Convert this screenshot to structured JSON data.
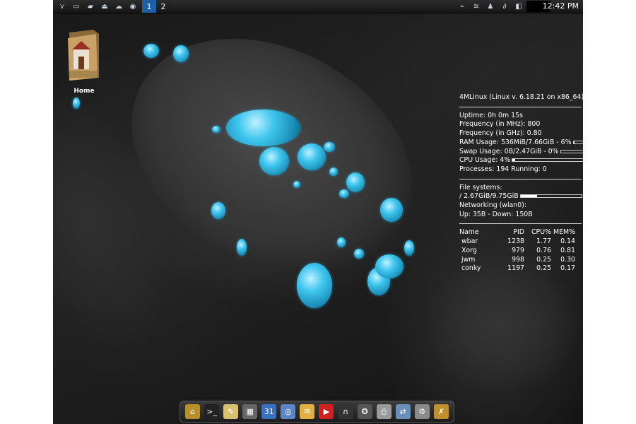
{
  "top_panel": {
    "workspaces": [
      "1",
      "2"
    ],
    "active_workspace": "1",
    "clock": "12:42 PM"
  },
  "desktop": {
    "home_icon_label": "Home"
  },
  "conky": {
    "header": "4MLinux (Linux v. 6.18.21 on x86_64)",
    "uptime": "Uptime: 0h 0m 15s",
    "freq_mhz": "Frequency (in MHz): 800",
    "freq_ghz": "Frequency (in GHz): 0.80",
    "ram": "RAM Usage: 536MiB/7.66GiB - 6%",
    "ram_percent": 6,
    "swap": "Swap Usage: 0B/2.47GiB - 0%",
    "swap_percent": 0,
    "cpu": "CPU Usage: 4%",
    "cpu_percent": 4,
    "processes": "Processes: 194  Running: 0",
    "filesystems_label": "File systems:",
    "root_fs": " /  2.67GiB/9.75GiB",
    "root_fs_percent": 27,
    "networking": "Networking (wlan0):",
    "updown": "Up: 35B  - Down: 150B",
    "proc_header": [
      "Name",
      "PID",
      "CPU%",
      "MEM%"
    ],
    "processes_list": [
      {
        "name": "wbar",
        "pid": "1238",
        "cpu": "1.77",
        "mem": "0.14"
      },
      {
        "name": "Xorg",
        "pid": "979",
        "cpu": "0.76",
        "mem": "0.81"
      },
      {
        "name": "jwm",
        "pid": "998",
        "cpu": "0.25",
        "mem": "0.30"
      },
      {
        "name": "conky",
        "pid": "1197",
        "cpu": "0.25",
        "mem": "0.17"
      }
    ]
  },
  "dock": {
    "icons": [
      {
        "name": "home-folder-icon",
        "color": "#b8902a",
        "glyph": "⌂"
      },
      {
        "name": "terminal-icon",
        "color": "#222222",
        "glyph": ">_"
      },
      {
        "name": "text-editor-icon",
        "color": "#d8c070",
        "glyph": "✎"
      },
      {
        "name": "calculator-icon",
        "color": "#666666",
        "glyph": "▦"
      },
      {
        "name": "calendar-icon",
        "color": "#3a70c0",
        "glyph": "31"
      },
      {
        "name": "web-browser-icon",
        "color": "#5a86c8",
        "glyph": "◎"
      },
      {
        "name": "email-icon",
        "color": "#e0b040",
        "glyph": "✉"
      },
      {
        "name": "youtube-icon",
        "color": "#d02020",
        "glyph": "▶"
      },
      {
        "name": "headphones-icon",
        "color": "#333333",
        "glyph": "∩"
      },
      {
        "name": "video-reel-icon",
        "color": "#555555",
        "glyph": "✪"
      },
      {
        "name": "printer-icon",
        "color": "#9a9a9a",
        "glyph": "⎙"
      },
      {
        "name": "network-icon",
        "color": "#6a8fb8",
        "glyph": "⇄"
      },
      {
        "name": "settings-icon",
        "color": "#8a8a8a",
        "glyph": "⚙"
      },
      {
        "name": "tools-icon",
        "color": "#c09030",
        "glyph": "✗"
      }
    ]
  }
}
